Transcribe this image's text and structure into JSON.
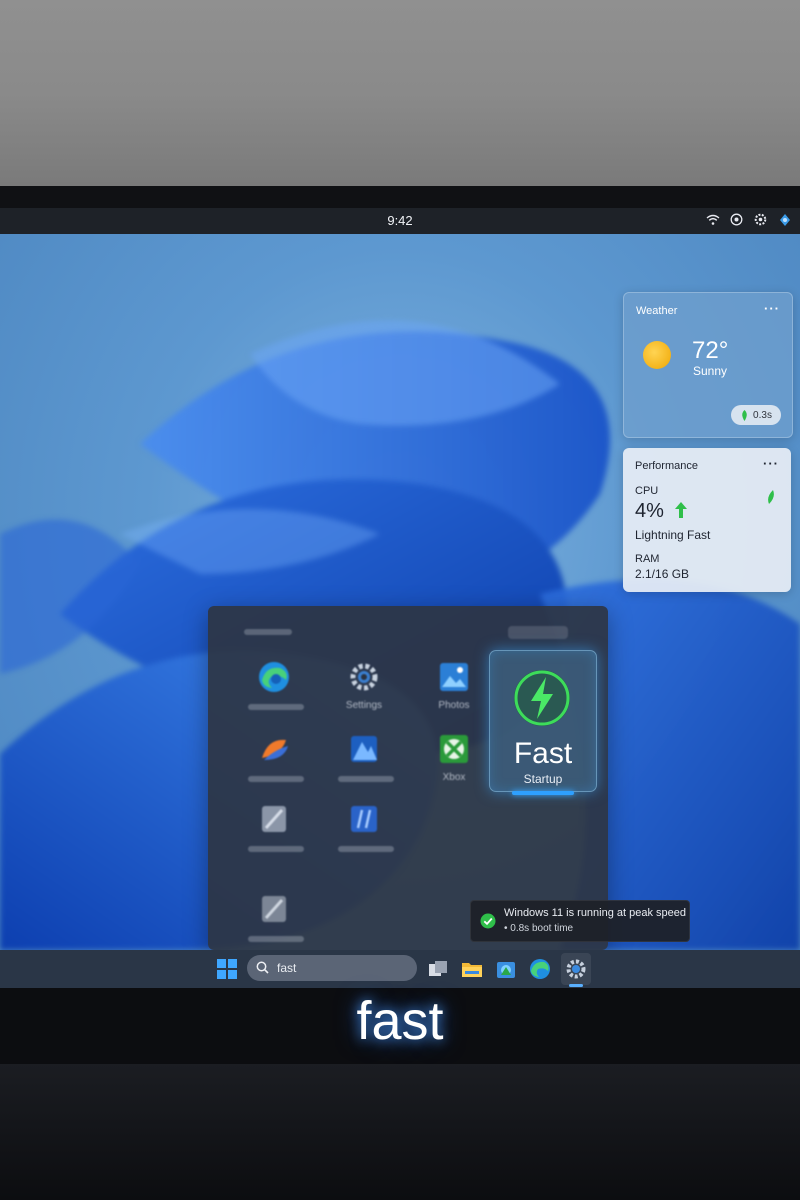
{
  "status_bar": {
    "time": "9:42",
    "tray_icons": [
      "wifi-icon",
      "settings-icon",
      "gear-icon",
      "notification-icon"
    ]
  },
  "weather_widget": {
    "title": "Weather",
    "more": "···",
    "temperature": "72°",
    "condition": "Sunny",
    "badge": "0.3s",
    "icon": "sun-icon"
  },
  "performance_widget": {
    "title": "Performance",
    "more": "···",
    "cpu_label": "CPU",
    "cpu_value": "4%",
    "status": "Lightning Fast",
    "ram_label": "RAM",
    "ram_value": "2.1/16 GB"
  },
  "start_menu": {
    "apps": [
      {
        "label": "",
        "icon": "edge-icon"
      },
      {
        "label": "Settings",
        "icon": "settings-gear-icon"
      },
      {
        "label": "Photos",
        "icon": "photos-icon"
      },
      {
        "label": "",
        "icon": "app-icon"
      },
      {
        "label": "",
        "icon": "app-icon"
      },
      {
        "label": "Xbox",
        "icon": "xbox-icon"
      },
      {
        "label": "",
        "icon": "app-icon"
      },
      {
        "label": "",
        "icon": "app-icon"
      },
      {
        "label": "",
        "icon": "app-icon"
      }
    ],
    "feature_tile": {
      "title": "Fast",
      "subtitle": "Startup",
      "icon": "lightning-bolt-icon"
    }
  },
  "toast": {
    "line1": "Windows 11 is running at peak speed",
    "line2": "• 0.8s boot time",
    "icon": "check-circle-icon"
  },
  "taskbar": {
    "search_text": "fast",
    "icons": [
      "windows-start-icon",
      "search-icon",
      "task-view-icon",
      "file-explorer-icon",
      "store-icon",
      "edge-icon",
      "settings-icon"
    ]
  },
  "caption": "fast",
  "colors": {
    "accent": "#2ea0ff",
    "success": "#2fbf4a",
    "taskbar": "#2c384a"
  }
}
